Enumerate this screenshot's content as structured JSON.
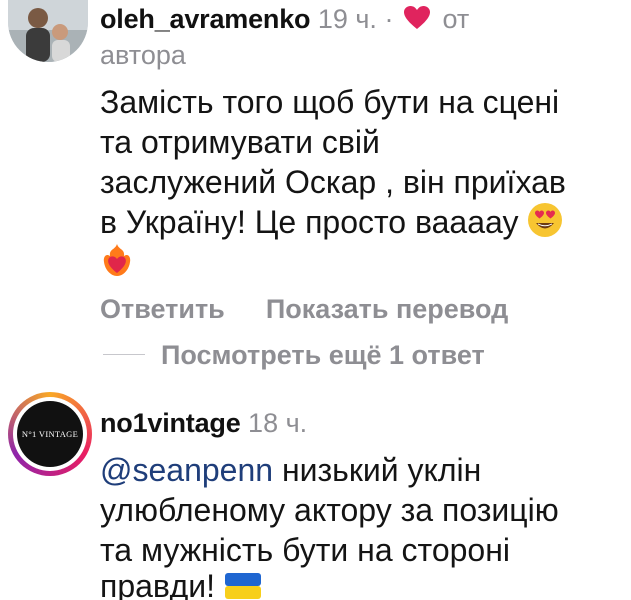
{
  "comments": [
    {
      "username": "oleh_avramenko",
      "time": "19 ч.",
      "separator": "·",
      "author_like": "от",
      "author_like_line2": "автора",
      "text_lines": [
        "Замість того щоб бути на сцені",
        "та отримувати свій",
        "заслужений Оскар , він приїхав",
        "в Україну! Це просто ваааау"
      ],
      "emoji": [
        "heart-eyes-emoji",
        "heart-on-fire-emoji"
      ],
      "actions": {
        "reply": "Ответить",
        "translate": "Показать перевод"
      },
      "view_replies": "Посмотреть ещё 1 ответ"
    },
    {
      "username": "no1vintage",
      "time": "18 ч.",
      "avatar_text": "N°1 VINTAGE",
      "mention": "@seanpenn",
      "text_lines": [
        " низький уклін",
        "улюбленому актору за позицію",
        "та мужність бути на стороні",
        "правди!"
      ],
      "emoji": [
        "ukraine-flag-emoji"
      ]
    }
  ],
  "colors": {
    "text": "#141414",
    "meta": "#8e8e93",
    "mention": "#1f3e7a",
    "heart": "#e0245e"
  }
}
